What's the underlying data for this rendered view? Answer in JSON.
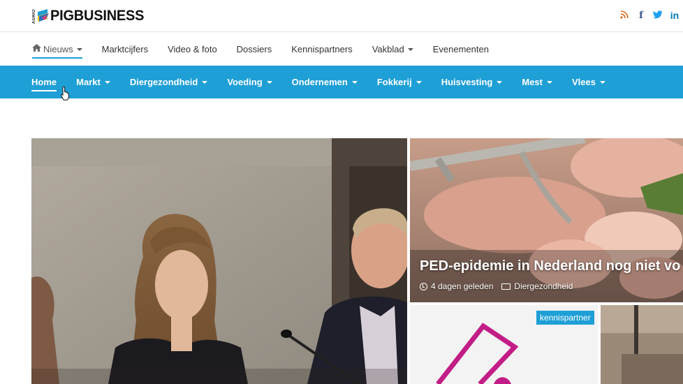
{
  "brand": {
    "name": "PIGBUSINESS",
    "sub": "AGRIO"
  },
  "social": [
    "rss-icon",
    "facebook-icon",
    "twitter-icon",
    "linkedin-icon"
  ],
  "subnav": [
    {
      "label": "Nieuws",
      "dropdown": true,
      "active": true
    },
    {
      "label": "Marktcijfers"
    },
    {
      "label": "Video & foto"
    },
    {
      "label": "Dossiers"
    },
    {
      "label": "Kennispartners"
    },
    {
      "label": "Vakblad",
      "dropdown": true
    },
    {
      "label": "Evenementen"
    }
  ],
  "mainnav": [
    {
      "label": "Home",
      "active": true
    },
    {
      "label": "Markt",
      "dropdown": true
    },
    {
      "label": "Diergezondheid",
      "dropdown": true
    },
    {
      "label": "Voeding",
      "dropdown": true
    },
    {
      "label": "Ondernemen",
      "dropdown": true
    },
    {
      "label": "Fokkerij",
      "dropdown": true
    },
    {
      "label": "Huisvesting",
      "dropdown": true
    },
    {
      "label": "Mest",
      "dropdown": true
    },
    {
      "label": "Vlees",
      "dropdown": true
    }
  ],
  "articles": {
    "top": {
      "title": "PED-epidemie in Nederland nog niet vo",
      "time": "4 dagen geleden",
      "category": "Diergezondheid"
    },
    "bottom_left": {
      "badge": "kennispartner"
    }
  },
  "colors": {
    "accent": "#1e9fd6",
    "rss": "#e06a1b",
    "facebook": "#3b5998",
    "twitter": "#1da1f2",
    "linkedin": "#0077b5"
  }
}
